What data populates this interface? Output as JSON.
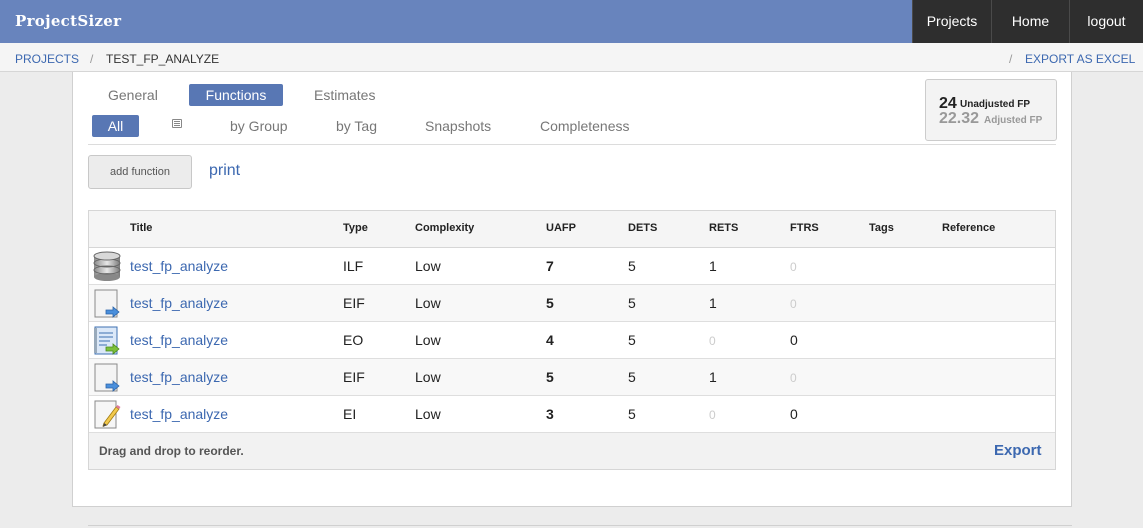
{
  "app": {
    "brand": "ProjectSizer"
  },
  "topnav": {
    "projects": "Projects",
    "home": "Home",
    "logout": "logout"
  },
  "breadcrumb": {
    "projects": "PROJECTS",
    "separator": "/",
    "current": "TEST_FP_ANALYZE",
    "export_separator": "/",
    "export": "EXPORT AS EXCEL"
  },
  "tabs": {
    "general": "General",
    "functions": "Functions",
    "estimates": "Estimates"
  },
  "subtabs": {
    "all": "All",
    "list_icon": "list-icon",
    "by_group": "by Group",
    "by_tag": "by Tag",
    "snapshots": "Snapshots",
    "completeness": "Completeness"
  },
  "fp_summary": {
    "unadjusted_value": "24",
    "unadjusted_label": "Unadjusted FP",
    "adjusted_value": "22.32",
    "adjusted_label": "Adjusted FP"
  },
  "actions": {
    "add_function": "add function",
    "print": "print"
  },
  "table": {
    "columns": [
      "Title",
      "Type",
      "Complexity",
      "UAFP",
      "DETS",
      "RETS",
      "FTRS",
      "Tags",
      "Reference"
    ],
    "rows": [
      {
        "icon": "database-icon",
        "title": "test_fp_analyze",
        "type": "ILF",
        "complexity": "Low",
        "uafp": "7",
        "dets": "5",
        "rets": "1",
        "ftrs": "0",
        "tags": "",
        "reference": ""
      },
      {
        "icon": "external-interface-icon",
        "title": "test_fp_analyze",
        "type": "EIF",
        "complexity": "Low",
        "uafp": "5",
        "dets": "5",
        "rets": "1",
        "ftrs": "0",
        "tags": "",
        "reference": ""
      },
      {
        "icon": "external-output-icon",
        "title": "test_fp_analyze",
        "type": "EO",
        "complexity": "Low",
        "uafp": "4",
        "dets": "5",
        "rets": "0",
        "ftrs": "0",
        "tags": "",
        "reference": ""
      },
      {
        "icon": "external-interface-icon",
        "title": "test_fp_analyze",
        "type": "EIF",
        "complexity": "Low",
        "uafp": "5",
        "dets": "5",
        "rets": "1",
        "ftrs": "0",
        "tags": "",
        "reference": ""
      },
      {
        "icon": "external-input-icon",
        "title": "test_fp_analyze",
        "type": "EI",
        "complexity": "Low",
        "uafp": "3",
        "dets": "5",
        "rets": "0",
        "ftrs": "0",
        "tags": "",
        "reference": ""
      }
    ],
    "footer": {
      "hint": "Drag and drop to reorder.",
      "export": "Export"
    }
  },
  "colors": {
    "topbar": "#6884bd",
    "link": "#3c68b0",
    "active_tab": "#5877b4",
    "nav_dark": "#2e2e2e"
  }
}
